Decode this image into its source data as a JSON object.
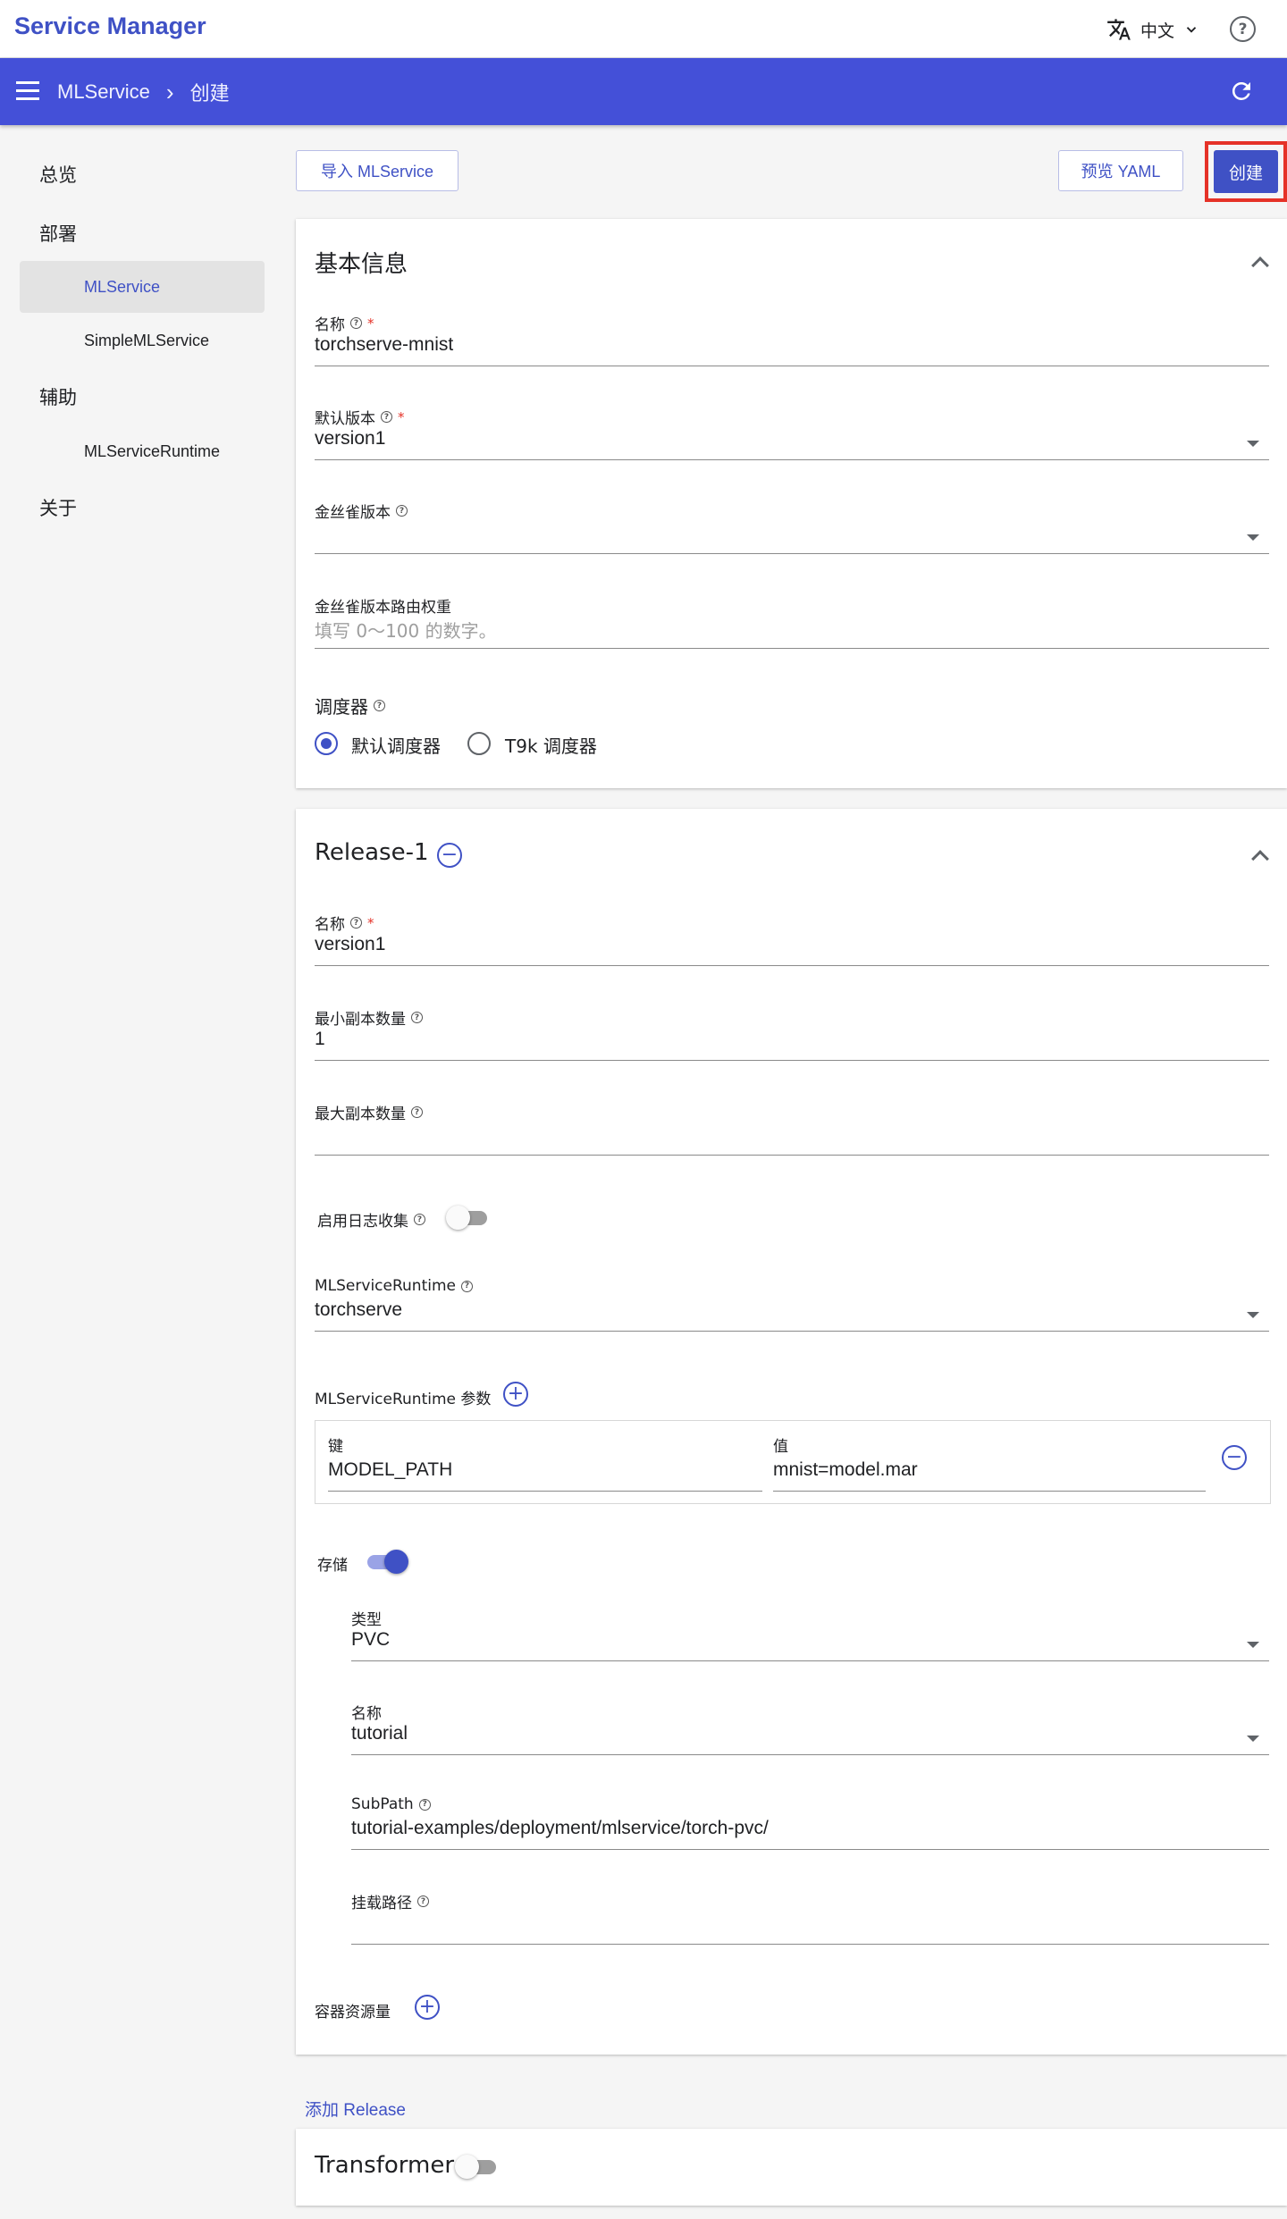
{
  "app": {
    "title": "Service Manager",
    "language": "中文",
    "icons": [
      "translate-icon",
      "chevron-down-icon",
      "help-icon",
      "menu-icon",
      "refresh-icon"
    ]
  },
  "breadcrumb": {
    "section": "MLService",
    "separator": "›",
    "current": "创建"
  },
  "sidebar": {
    "groups": [
      {
        "label": "总览"
      },
      {
        "label": "部署",
        "items": [
          "MLService",
          "SimpleMLService"
        ]
      },
      {
        "label": "辅助",
        "items": [
          "MLServiceRuntime"
        ]
      },
      {
        "label": "关于"
      }
    ],
    "active": "MLService"
  },
  "toolbar": {
    "import_label": "导入 MLService",
    "preview_label": "预览 YAML",
    "create_label": "创建"
  },
  "basic": {
    "title": "基本信息",
    "name_label": "名称",
    "name_value": "torchserve-mnist",
    "default_version_label": "默认版本",
    "default_version_value": "version1",
    "canary_version_label": "金丝雀版本",
    "canary_version_value": "",
    "canary_weight_label": "金丝雀版本路由权重",
    "canary_weight_placeholder": "填写 0～100 的数字。",
    "scheduler_label": "调度器",
    "scheduler_options": [
      "默认调度器",
      "T9k 调度器"
    ],
    "scheduler_selected": "默认调度器"
  },
  "release": {
    "title": "Release-1",
    "name_label": "名称",
    "name_value": "version1",
    "min_replicas_label": "最小副本数量",
    "min_replicas_value": "1",
    "max_replicas_label": "最大副本数量",
    "max_replicas_value": "",
    "logging_label": "启用日志收集",
    "logging_enabled": false,
    "runtime_label": "MLServiceRuntime",
    "runtime_value": "torchserve",
    "runtime_params_label": "MLServiceRuntime 参数",
    "params": [
      {
        "key_label": "键",
        "key": "MODEL_PATH",
        "value_label": "值",
        "value": "mnist=model.mar"
      }
    ],
    "storage_label": "存储",
    "storage_enabled": true,
    "storage": {
      "type_label": "类型",
      "type_value": "PVC",
      "name_label": "名称",
      "name_value": "tutorial",
      "subpath_label": "SubPath",
      "subpath_value": "tutorial-examples/deployment/mlservice/torch-pvc/",
      "mount_label": "挂载路径",
      "mount_value": ""
    },
    "resources_label": "容器资源量"
  },
  "add_release_label": "添加 Release",
  "transformer": {
    "title": "Transformer",
    "enabled": false
  },
  "colors": {
    "primary": "#3f51c5",
    "navbar": "#4450d8",
    "highlight": "#e53228"
  }
}
